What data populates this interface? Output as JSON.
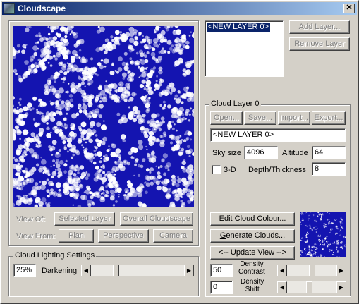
{
  "window": {
    "title": "Cloudscape",
    "close_glyph": "✕"
  },
  "layers": {
    "items": [
      "<NEW LAYER 0>"
    ],
    "add_label": "Add Layer...",
    "remove_label": "Remove Layer"
  },
  "view": {
    "view_of_label": "View Of:",
    "selected_layer_label": "Selected Layer",
    "overall_label": "Overall Cloudscape",
    "view_from_label": "View From:",
    "plan_label": "Plan",
    "perspective_label": "Perspective",
    "camera_label": "Camera"
  },
  "lighting": {
    "title": "Cloud Lighting Settings",
    "value": "25%",
    "label": "Darkening",
    "level_percent": 25
  },
  "cloud_layer": {
    "title": "Cloud Layer 0",
    "open_label": "Open...",
    "save_label": "Save...",
    "import_label": "Import...",
    "export_label": "Export...",
    "name_value": "<NEW LAYER 0>",
    "sky_size_label": "Sky size",
    "sky_size_value": "4096",
    "altitude_label": "Altitude",
    "altitude_value": "64",
    "threed_label": "3-D",
    "threed_checked": false,
    "depth_label": "Depth/Thickness",
    "depth_value": "8",
    "edit_colour_label": "Edit Cloud Colour...",
    "generate_label": "Generate Clouds...",
    "update_label": "<-- Update View -->",
    "density_contrast_value": "50",
    "density_contrast_label_1": "Density",
    "density_contrast_label_2": "Contrast",
    "density_contrast_level_percent": 50,
    "density_shift_value": "0",
    "density_shift_label_1": "Density",
    "density_shift_label_2": "Shift",
    "density_shift_level_percent": 45
  },
  "icons": {
    "close": "close-icon",
    "app": "cloudscape-app-icon",
    "scroll_left": "arrow-left-icon",
    "scroll_right": "arrow-right-icon"
  },
  "colors": {
    "sky_blue": "#1414b0",
    "cloud_white": "#ffffff",
    "title_active": "#0a246a",
    "selection": "#0a246a"
  }
}
